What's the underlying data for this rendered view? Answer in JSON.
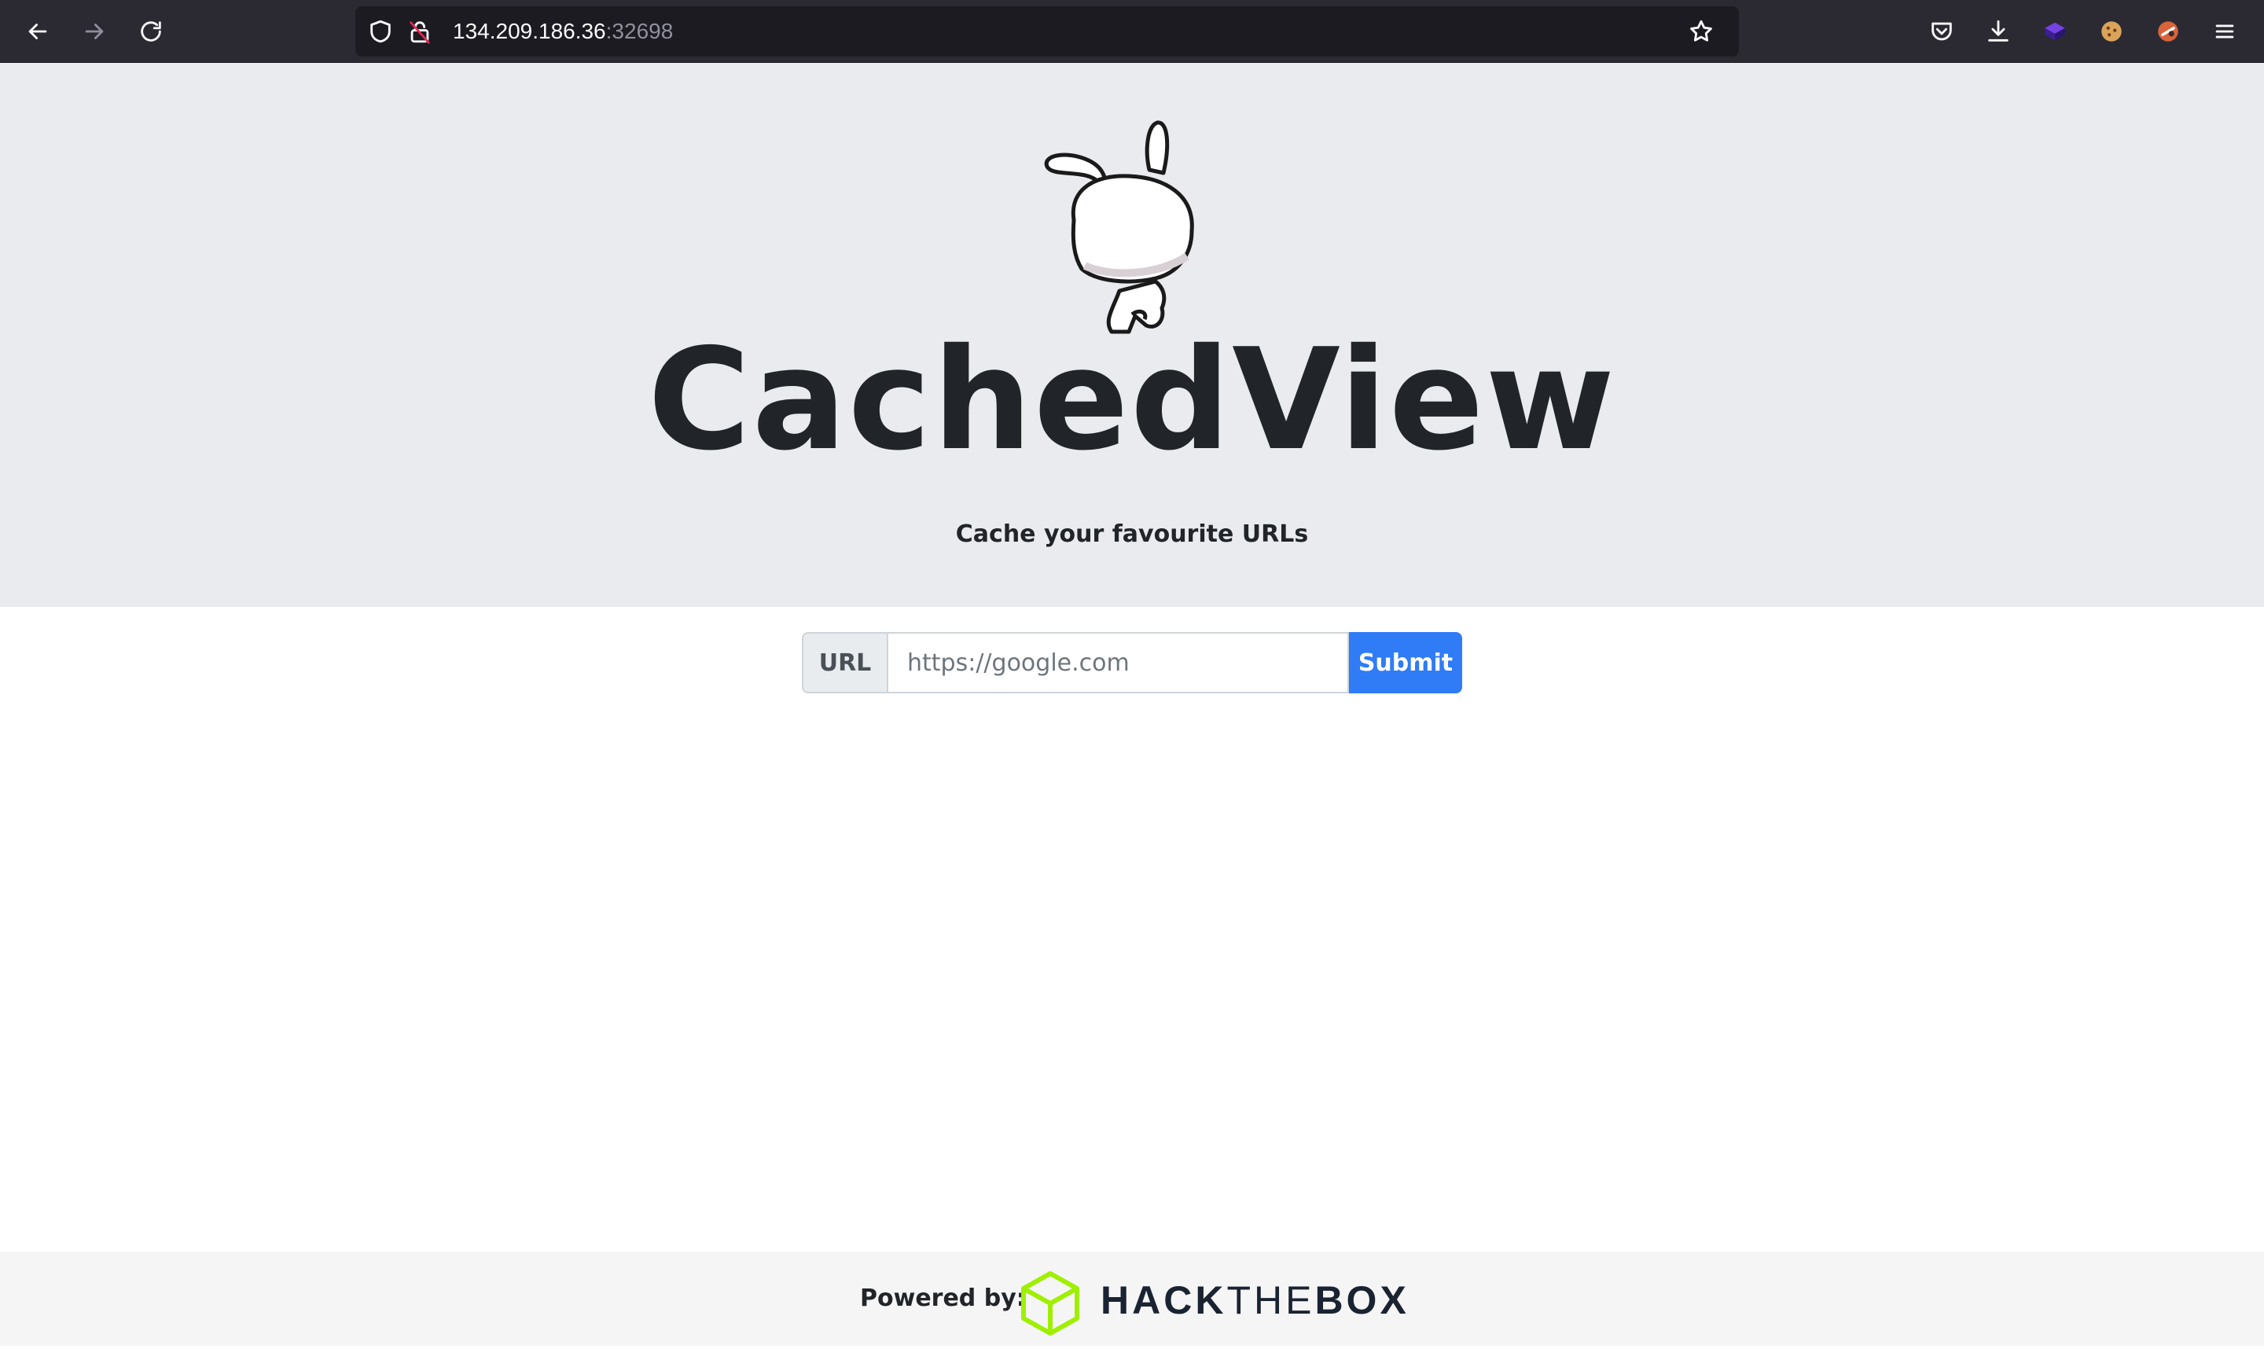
{
  "browser": {
    "url_host": "134.209.186.36",
    "url_port": ":32698",
    "icons": {
      "back": "back-arrow-icon",
      "forward": "forward-arrow-icon",
      "reload": "reload-icon",
      "shield": "tracking-protection-shield-icon",
      "insecure_lock": "insecure-lock-icon",
      "bookmark": "bookmark-star-icon",
      "pocket": "pocket-icon",
      "downloads": "download-icon",
      "extensions": [
        "purple-cube-extension-icon",
        "cookie-extension-icon",
        "red-extension-icon"
      ],
      "menu": "hamburger-menu-icon"
    }
  },
  "hero": {
    "title": "CachedView",
    "subtitle": "Cache your favourite URLs",
    "background_color": "#e9ebee"
  },
  "form": {
    "label": "URL",
    "placeholder": "https://google.com",
    "value": "",
    "submit_label": "Submit",
    "accent_color": "#2f7cf6"
  },
  "footer": {
    "powered_by": "Powered by:",
    "brand_part1": "HACK",
    "brand_part2": "THE",
    "brand_part3": "BOX",
    "brand_color": "#9fef00"
  }
}
